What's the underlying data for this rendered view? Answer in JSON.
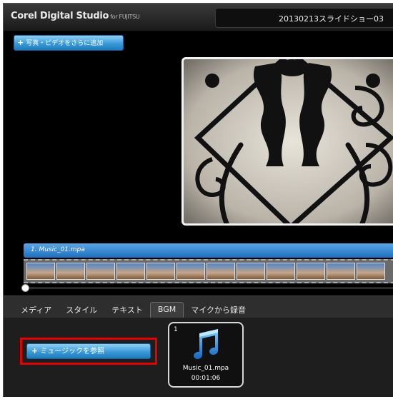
{
  "app": {
    "title": "Corel Digital Studio",
    "title_suffix": "for FUJITSU",
    "project_name": "20130213スライドショー03"
  },
  "toolbar": {
    "add_media_label": "写真・ビデオをさらに追加"
  },
  "timeline": {
    "music_track_label": "1. Music_01.mpa",
    "thumbnail_count": 12
  },
  "tabs": [
    {
      "label": "メディア",
      "active": false
    },
    {
      "label": "スタイル",
      "active": false
    },
    {
      "label": "テキスト",
      "active": false
    },
    {
      "label": "BGM",
      "active": true
    },
    {
      "label": "マイクから録音",
      "active": false
    }
  ],
  "bgm": {
    "browse_label": "ミュージックを参照",
    "card": {
      "index": "1",
      "filename": "Music_01.mpa",
      "duration": "00:01:06",
      "icon": "music-note-icon"
    }
  },
  "colors": {
    "accent_blue": "#3a9bd8",
    "highlight_red": "#e00000",
    "background": "#000000"
  }
}
